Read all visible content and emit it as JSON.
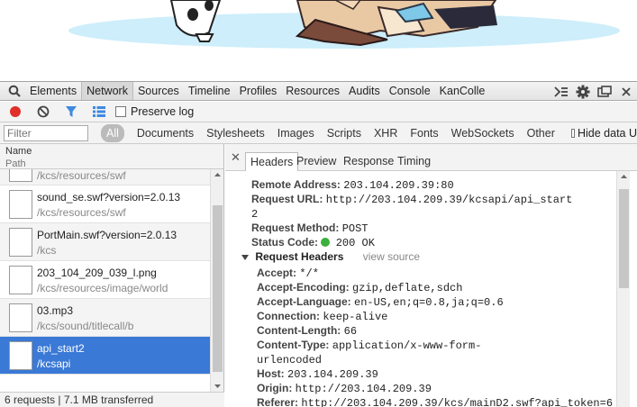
{
  "devtools": {
    "tabs": [
      "Elements",
      "Network",
      "Sources",
      "Timeline",
      "Profiles",
      "Resources",
      "Audits",
      "Console",
      "KanColle"
    ],
    "active_tab": "Network"
  },
  "network_toolbar": {
    "preserve_log": "Preserve log"
  },
  "filter_bar": {
    "placeholder": "Filter",
    "all": "All",
    "types": [
      "Documents",
      "Stylesheets",
      "Images",
      "Scripts",
      "XHR",
      "Fonts",
      "WebSockets",
      "Other"
    ],
    "hide_data": "Hide data U"
  },
  "request_list": {
    "header_name": "Name",
    "header_path": "Path",
    "partial_path": "/kcs/resources/swf",
    "rows": [
      {
        "name": "sound_se.swf?version=2.0.13",
        "path": "/kcs/resources/swf"
      },
      {
        "name": "PortMain.swf?version=2.0.13",
        "path": "/kcs"
      },
      {
        "name": "203_104_209_039_l.png",
        "path": "/kcs/resources/image/world"
      },
      {
        "name": "03.mp3",
        "path": "/kcs/sound/titlecall/b"
      },
      {
        "name": "api_start2",
        "path": "/kcsapi"
      }
    ],
    "status": "6 requests | 7.1 MB transferred"
  },
  "detail": {
    "tabs": [
      "Headers",
      "Preview",
      "Response",
      "Timing"
    ],
    "active_tab": "Headers",
    "general": [
      {
        "k": "Remote Address:",
        "v": "203.104.209.39:80"
      },
      {
        "k": "Request URL:",
        "v": "http://203.104.209.39/kcsapi/api_start"
      },
      {
        "k": "",
        "v": "2"
      },
      {
        "k": "Request Method:",
        "v": "POST"
      },
      {
        "k": "Status Code:",
        "v": "200 OK"
      }
    ],
    "request_headers_title": "Request Headers",
    "view_source": "view source",
    "request_headers": [
      {
        "k": "Accept:",
        "v": "*/*"
      },
      {
        "k": "Accept-Encoding:",
        "v": "gzip,deflate,sdch"
      },
      {
        "k": "Accept-Language:",
        "v": "en-US,en;q=0.8,ja;q=0.6"
      },
      {
        "k": "Connection:",
        "v": "keep-alive"
      },
      {
        "k": "Content-Length:",
        "v": "66"
      },
      {
        "k": "Content-Type:",
        "v": "application/x-www-form-"
      },
      {
        "k": "",
        "v": "urlencoded"
      },
      {
        "k": "Host:",
        "v": "203.104.209.39"
      },
      {
        "k": "Origin:",
        "v": "http://203.104.209.39"
      },
      {
        "k": "Referer:",
        "v": "http://203.104.209.39/kcs/mainD2.swf?api_token=6"
      }
    ]
  },
  "colors": {
    "selected_row": "#3a79d6",
    "record_red": "#e0302a",
    "filter_blue": "#3f8ae0",
    "status_green": "#3bb03b"
  }
}
